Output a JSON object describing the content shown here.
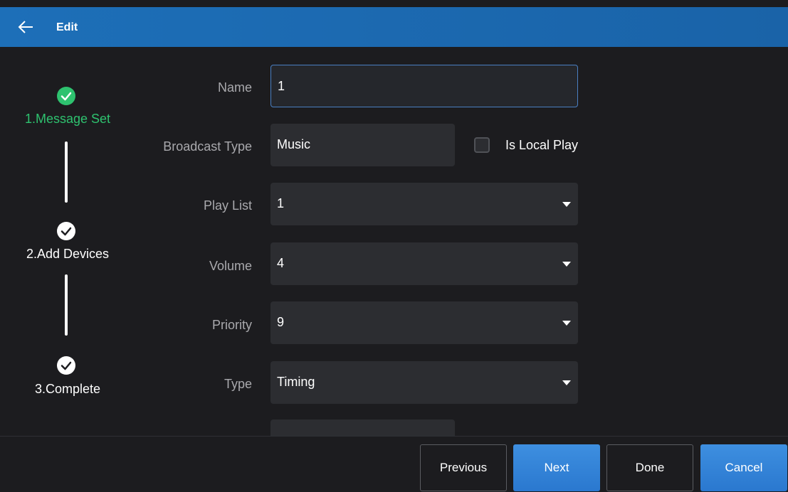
{
  "header": {
    "title": "Edit"
  },
  "steps": [
    {
      "label": "1.Message Set",
      "state": "active",
      "color": "#2ec26f"
    },
    {
      "label": "2.Add Devices",
      "state": "pending",
      "color": "#ffffff"
    },
    {
      "label": "3.Complete",
      "state": "pending",
      "color": "#ffffff"
    }
  ],
  "form": {
    "name": {
      "label": "Name",
      "value": "1"
    },
    "broadcast_type": {
      "label": "Broadcast Type",
      "value": "Music"
    },
    "is_local_play": {
      "label": "Is Local Play",
      "checked": false
    },
    "play_list": {
      "label": "Play List",
      "value": "1"
    },
    "volume": {
      "label": "Volume",
      "value": "4"
    },
    "priority": {
      "label": "Priority",
      "value": "9"
    },
    "type": {
      "label": "Type",
      "value": "Timing"
    }
  },
  "footer": {
    "previous": "Previous",
    "next": "Next",
    "done": "Done",
    "cancel": "Cancel"
  },
  "colors": {
    "header": "#1d6fb8",
    "accent_green": "#2ec26f",
    "primary_button": "#3a8ae0",
    "background": "#1c1c1f",
    "field": "#2c2d31"
  }
}
